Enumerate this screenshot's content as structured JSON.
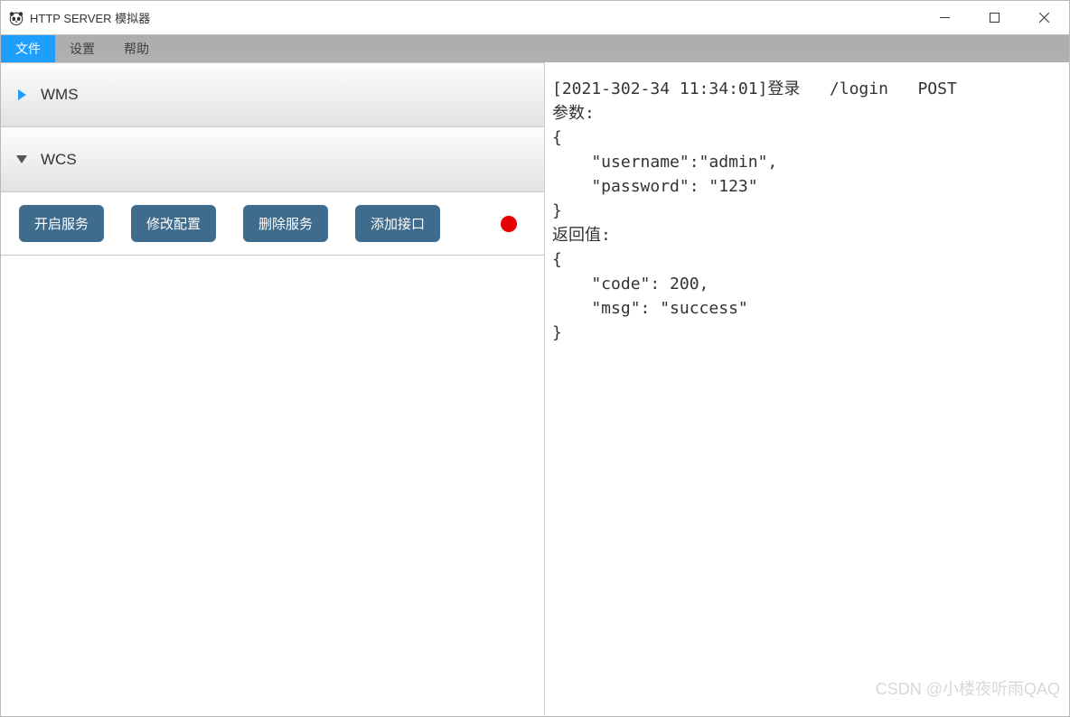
{
  "title": "HTTP SERVER 模拟器",
  "menu": {
    "file": "文件",
    "settings": "设置",
    "help": "帮助"
  },
  "accordion": {
    "wms": {
      "label": "WMS"
    },
    "wcs": {
      "label": "WCS",
      "buttons": {
        "start": "开启服务",
        "edit": "修改配置",
        "delete": "删除服务",
        "add": "添加接口"
      },
      "status_color": "#e60000"
    }
  },
  "log_text": "[2021-302-34 11:34:01]登录   /login   POST\n参数:\n{\n    \"username\":\"admin\",\n    \"password\": \"123\"\n}\n返回值:\n{\n    \"code\": 200,\n    \"msg\": \"success\"\n}",
  "watermark": "CSDN @小楼夜听雨QAQ"
}
